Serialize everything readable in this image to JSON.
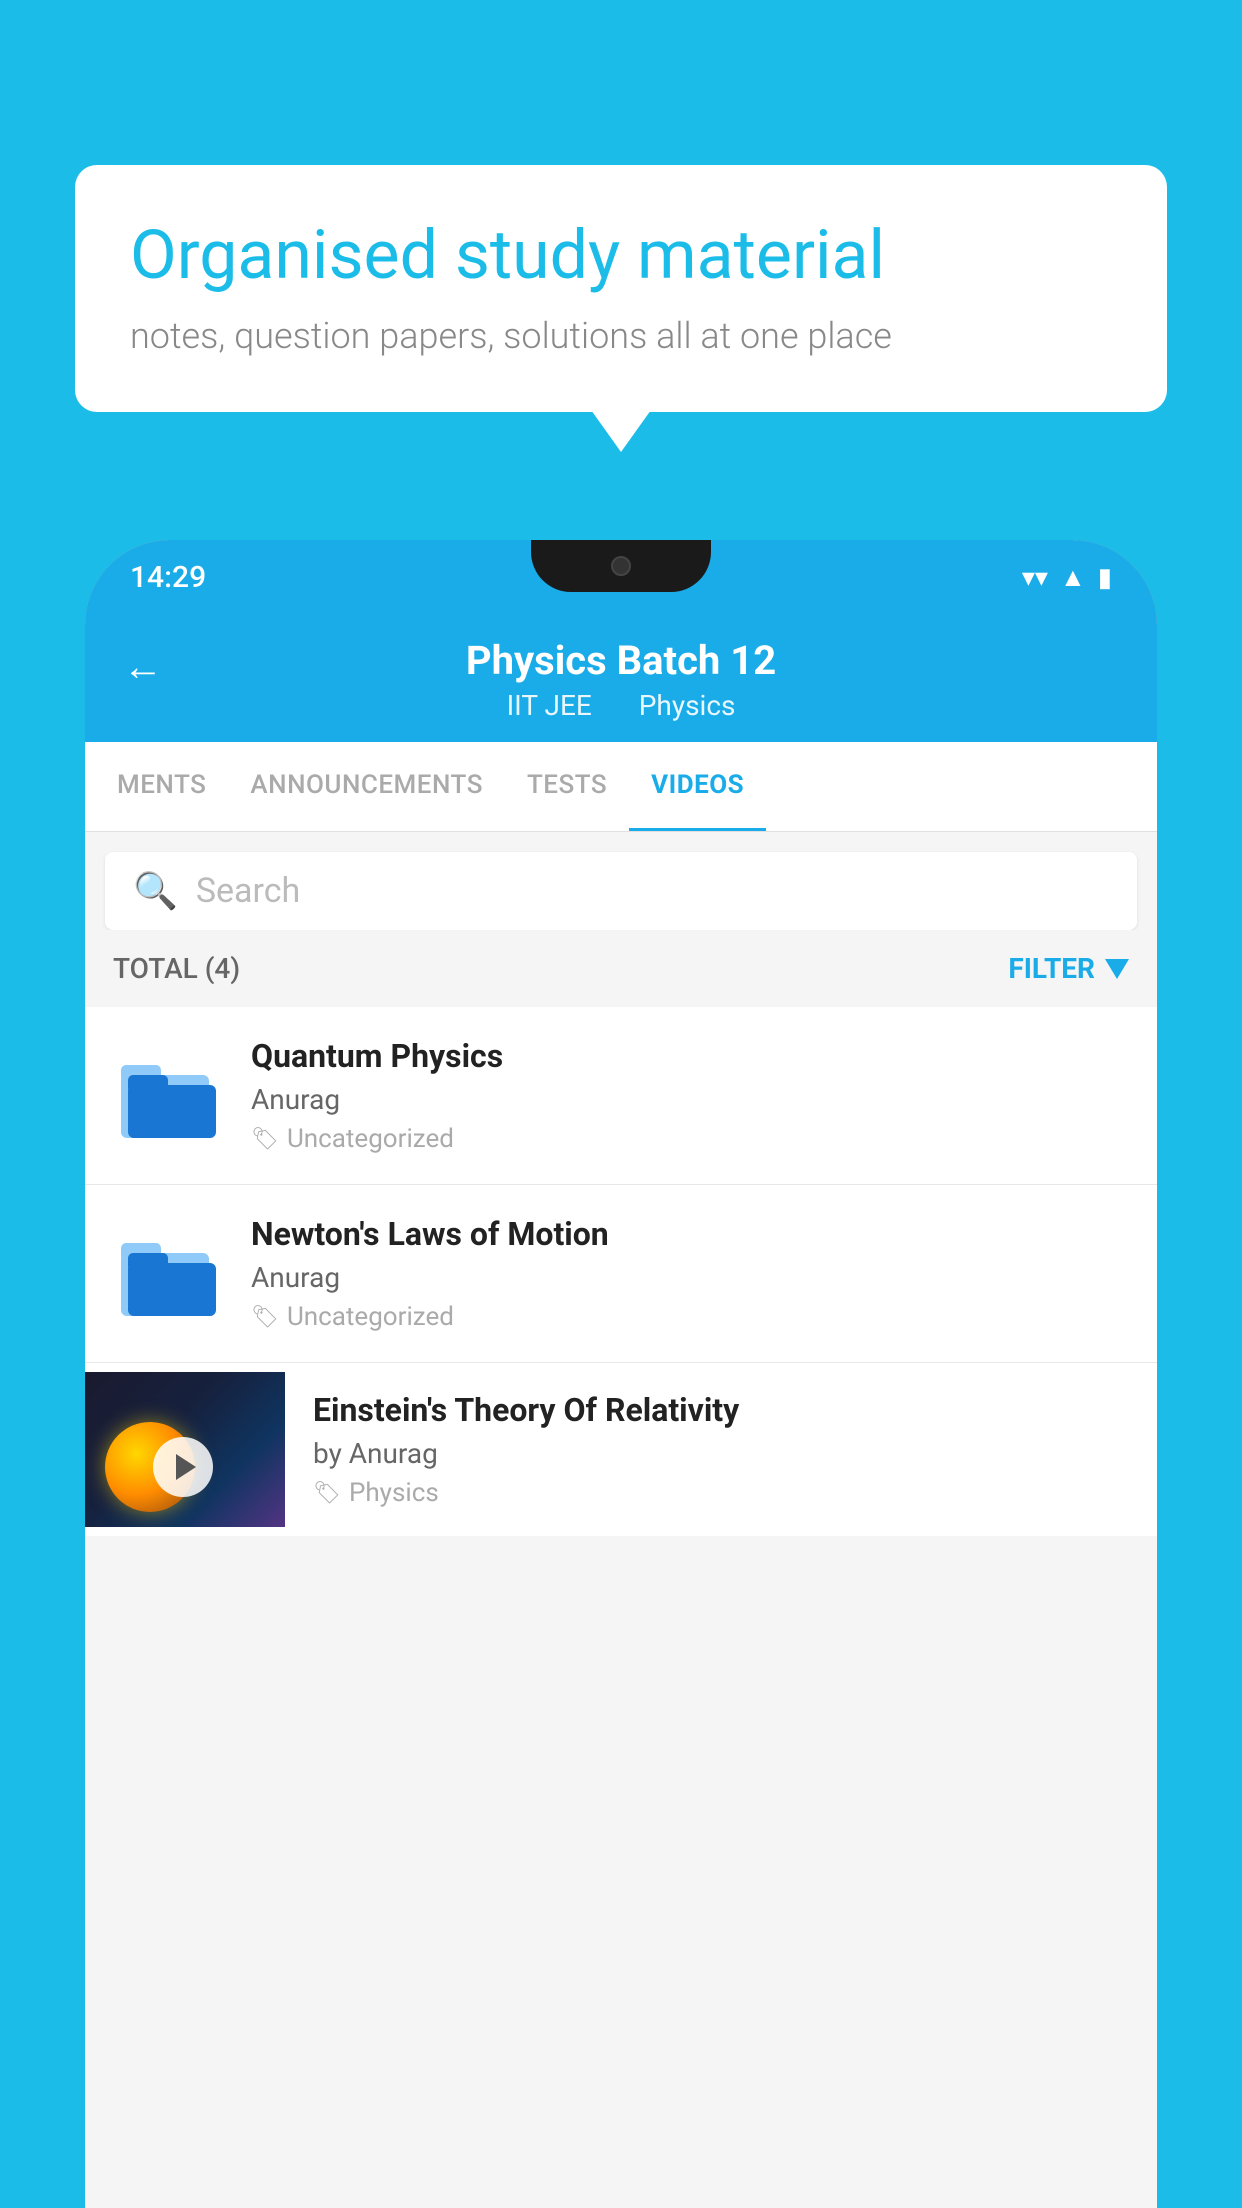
{
  "background_color": "#1bbde8",
  "bubble": {
    "title": "Organised study material",
    "subtitle": "notes, question papers, solutions all at one place"
  },
  "phone": {
    "status_bar": {
      "time": "14:29",
      "icons": [
        "wifi",
        "signal",
        "battery"
      ]
    },
    "header": {
      "back_label": "←",
      "title": "Physics Batch 12",
      "subtitle_part1": "IIT JEE",
      "subtitle_separator": "  ",
      "subtitle_part2": "Physics"
    },
    "tabs": [
      {
        "label": "MENTS",
        "active": false
      },
      {
        "label": "ANNOUNCEMENTS",
        "active": false
      },
      {
        "label": "TESTS",
        "active": false
      },
      {
        "label": "VIDEOS",
        "active": true
      }
    ],
    "search": {
      "placeholder": "Search"
    },
    "filter_bar": {
      "total_label": "TOTAL (4)",
      "filter_label": "FILTER"
    },
    "video_items": [
      {
        "title": "Quantum Physics",
        "author": "Anurag",
        "tag": "Uncategorized",
        "type": "folder"
      },
      {
        "title": "Newton's Laws of Motion",
        "author": "Anurag",
        "tag": "Uncategorized",
        "type": "folder"
      },
      {
        "title": "Einstein's Theory Of Relativity",
        "author": "by Anurag",
        "tag": "Physics",
        "type": "video"
      }
    ]
  }
}
